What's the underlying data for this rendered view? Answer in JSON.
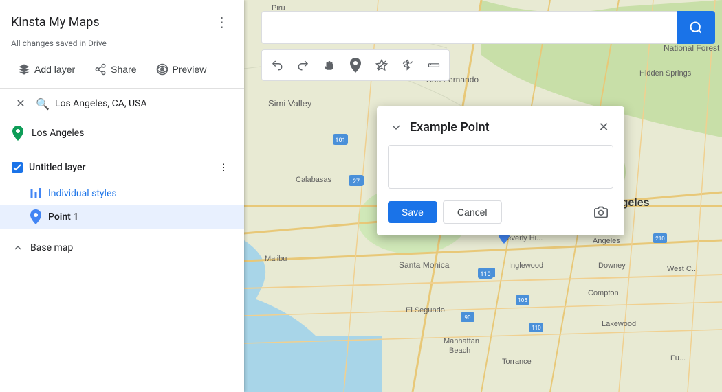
{
  "app": {
    "title": "Kinsta My Maps",
    "saved_status": "All changes saved in Drive"
  },
  "panel": {
    "menu_label": "⋮",
    "add_layer_label": "Add layer",
    "share_label": "Share",
    "preview_label": "Preview"
  },
  "search": {
    "query": "Los Angeles, CA, USA",
    "place": "Los Angeles",
    "placeholder": ""
  },
  "layer": {
    "title": "Untitled layer",
    "individual_styles_label": "Individual styles",
    "point_label": "Point 1"
  },
  "basemap": {
    "label": "Base map"
  },
  "toolbar": {
    "undo_label": "↩",
    "redo_label": "↪",
    "hand_label": "✋",
    "pin_label": "📍",
    "shape_label": "⬡",
    "route_label": "⇧",
    "ruler_label": "📏"
  },
  "popup": {
    "title": "Example Point",
    "save_label": "Save",
    "cancel_label": "Cancel",
    "description_placeholder": ""
  },
  "colors": {
    "blue": "#1a73e8",
    "selected_bg": "#e8f0fe",
    "text_primary": "#202124",
    "text_secondary": "#5f6368"
  }
}
